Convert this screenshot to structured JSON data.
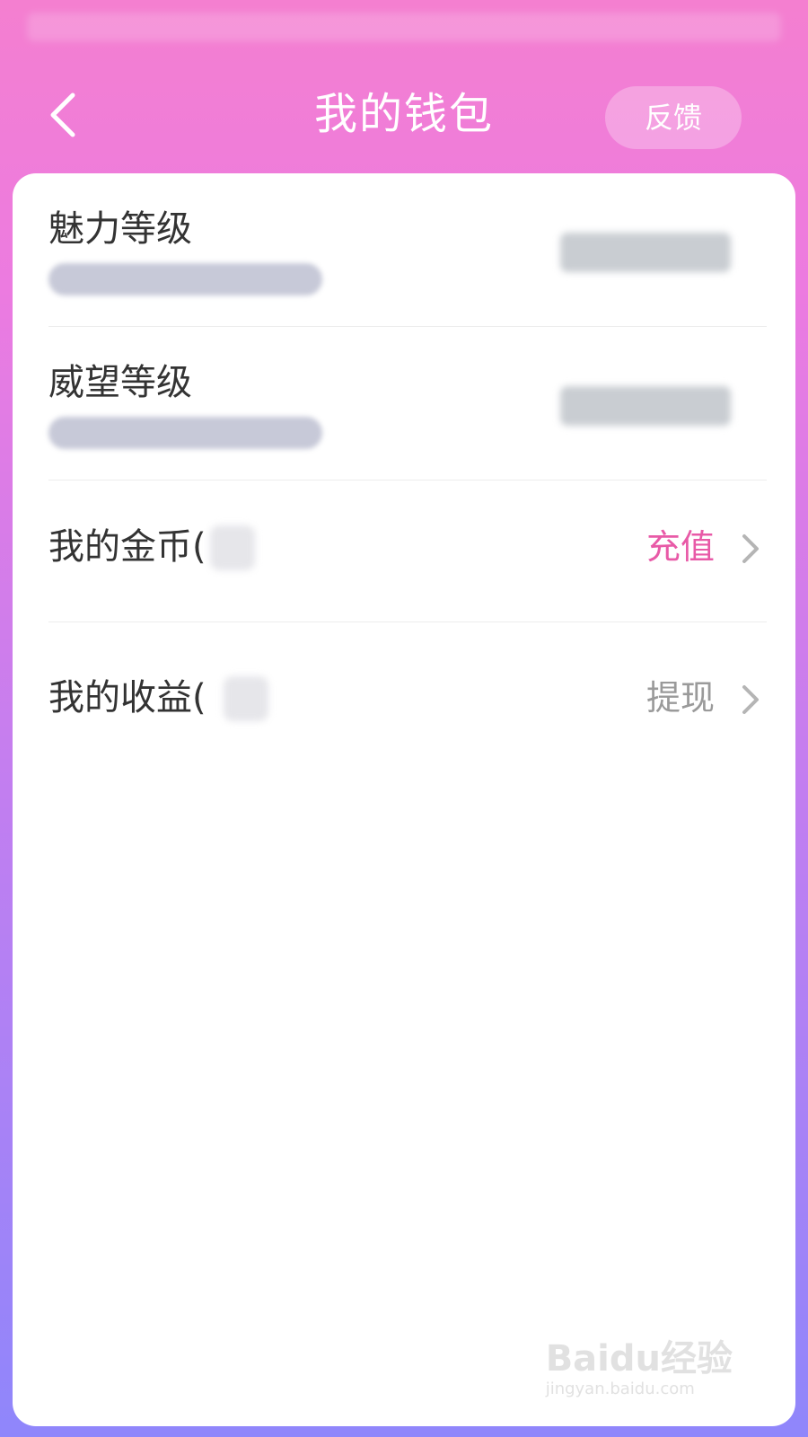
{
  "header": {
    "title": "我的钱包",
    "feedback_label": "反馈"
  },
  "levels": [
    {
      "label": "魅力等级"
    },
    {
      "label": "威望等级"
    }
  ],
  "actions": [
    {
      "label": "我的金币(",
      "action": "充值",
      "action_color": "#e85aa7"
    },
    {
      "label": "我的收益(",
      "action": "提现",
      "action_color": "#9a9a9a"
    }
  ],
  "watermark": {
    "logo": "Baidu经验",
    "url": "jingyan.baidu.com"
  },
  "colors": {
    "primary_gradient_top": "#f47fd0",
    "primary_gradient_bottom": "#8f86fb",
    "recharge_accent": "#e85aa7"
  },
  "icons": {
    "back": "chevron-left-icon",
    "row_arrow": "chevron-right-icon"
  }
}
